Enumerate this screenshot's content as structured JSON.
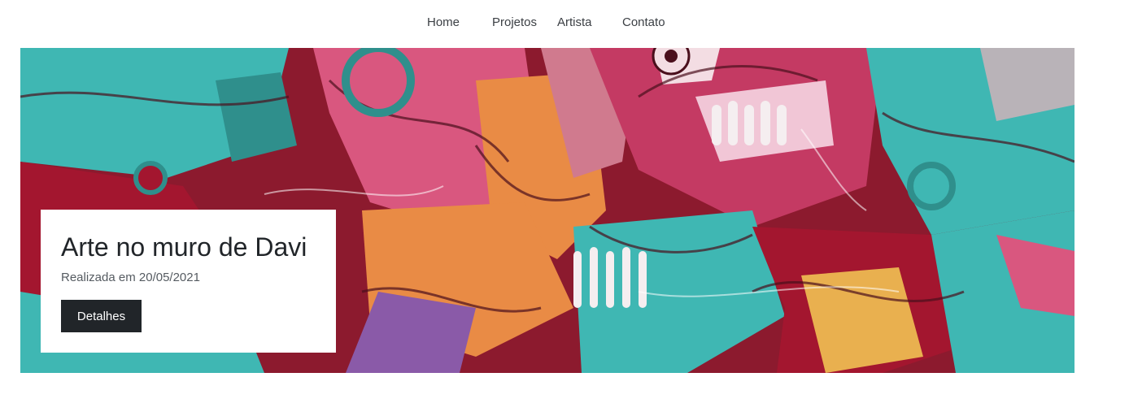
{
  "nav": {
    "items": [
      {
        "label": "Home"
      },
      {
        "label": "Projetos"
      },
      {
        "label": "Artista"
      },
      {
        "label": "Contato"
      }
    ]
  },
  "hero": {
    "image": "graffiti-mural-image",
    "colors": {
      "teal": "#3fb7b3",
      "crimson": "#a3162f",
      "pink": "#d9577f",
      "orange": "#e98b45",
      "purple": "#8a5aa8"
    }
  },
  "card": {
    "title": "Arte no muro de Davi",
    "date": "Realizada em 20/05/2021",
    "button_label": "Detalhes"
  }
}
